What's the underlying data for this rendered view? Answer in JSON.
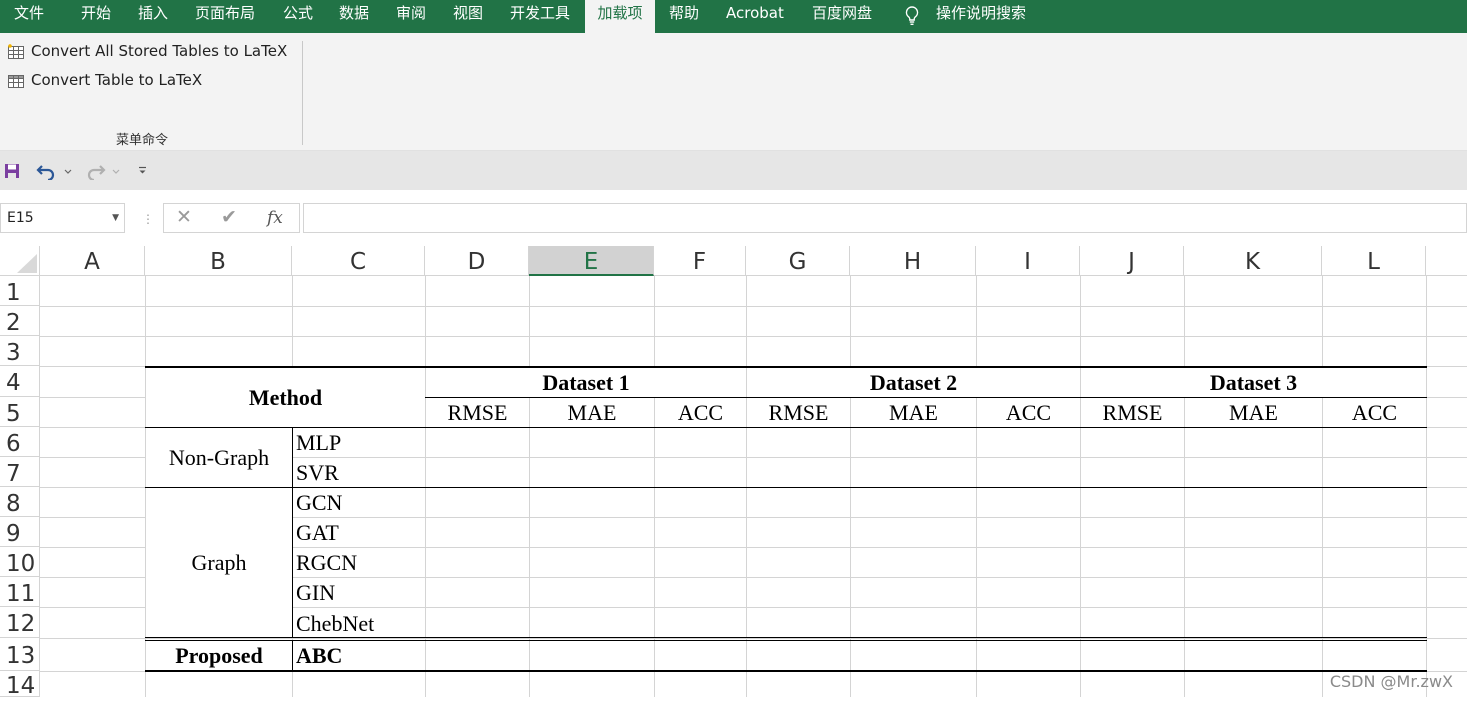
{
  "menu": {
    "tabs": [
      "文件",
      "开始",
      "插入",
      "页面布局",
      "公式",
      "数据",
      "审阅",
      "视图",
      "开发工具",
      "加载项",
      "帮助",
      "Acrobat",
      "百度网盘"
    ],
    "active_tab": "加载项",
    "search_label": "操作说明搜索"
  },
  "ribbon": {
    "commands": [
      "Convert All Stored Tables to LaTeX",
      "Convert Table to LaTeX"
    ],
    "group_label": "菜单命令"
  },
  "formula_bar": {
    "name_box": "E15",
    "fx_label": "fx",
    "value": ""
  },
  "grid": {
    "columns": [
      "A",
      "B",
      "C",
      "D",
      "E",
      "F",
      "G",
      "H",
      "I",
      "J",
      "K",
      "L"
    ],
    "selected_column": "E",
    "rows": [
      "1",
      "2",
      "3",
      "4",
      "5",
      "6",
      "7",
      "8",
      "9",
      "10",
      "11",
      "12",
      "13",
      "14"
    ]
  },
  "table": {
    "method_header": "Method",
    "datasets": [
      "Dataset 1",
      "Dataset 2",
      "Dataset 3"
    ],
    "metrics": [
      "RMSE",
      "MAE",
      "ACC",
      "RMSE",
      "MAE",
      "ACC",
      "RMSE",
      "MAE",
      "ACC"
    ],
    "group_non_graph": "Non-Graph",
    "non_graph_methods": [
      "MLP",
      "SVR"
    ],
    "group_graph": "Graph",
    "graph_methods": [
      "GCN",
      "GAT",
      "RGCN",
      "GIN",
      "ChebNet"
    ],
    "proposed_label": "Proposed",
    "proposed_method": "ABC"
  },
  "watermark": "CSDN @Mr.zwX",
  "colors": {
    "excel_green": "#217346",
    "ribbon_bg": "#f3f3f3",
    "gridline": "#d4d4d4"
  }
}
